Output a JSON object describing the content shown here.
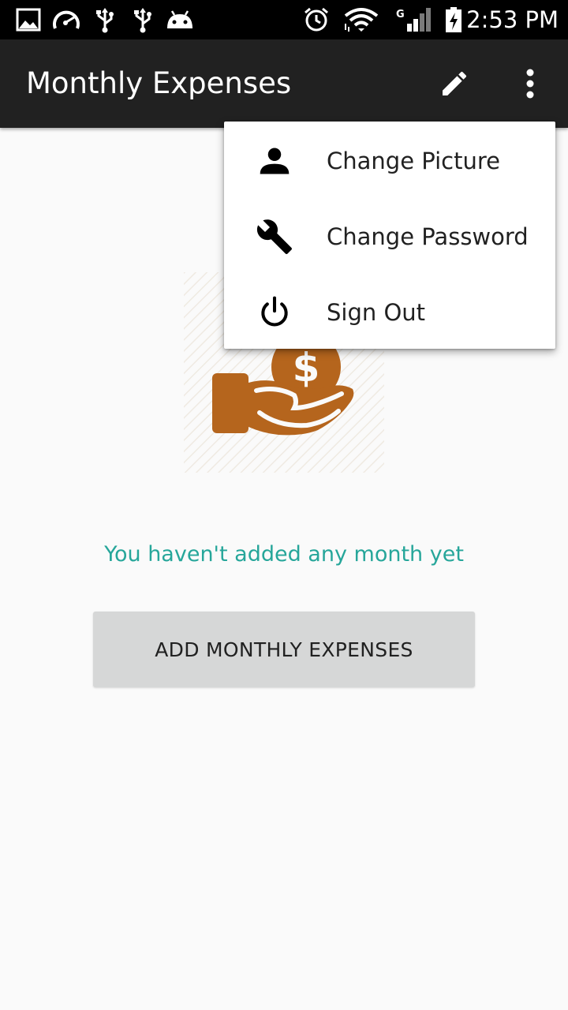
{
  "status_bar": {
    "time": "2:53 PM",
    "icons": [
      "gallery-icon",
      "speedometer-icon",
      "usb-icon",
      "usb-icon",
      "android-icon",
      "alarm-icon",
      "wifi-icon",
      "signal-icon",
      "battery-charging-icon"
    ],
    "network_type": "G"
  },
  "toolbar": {
    "title": "Monthly Expenses",
    "background": "#212121",
    "actions": [
      "edit-icon",
      "overflow-menu-icon"
    ]
  },
  "popup_menu": {
    "items": [
      {
        "label": "Change Picture",
        "icon": "person-icon"
      },
      {
        "label": "Change Password",
        "icon": "wrench-icon"
      },
      {
        "label": "Sign Out",
        "icon": "power-icon"
      }
    ]
  },
  "main": {
    "illustration": "hand-with-dollar-coin-icon",
    "illustration_color": "#b5651d",
    "empty_message": "You haven't added any month yet",
    "empty_message_color": "#26a69a",
    "add_button_label": "ADD MONTHLY EXPENSES"
  }
}
